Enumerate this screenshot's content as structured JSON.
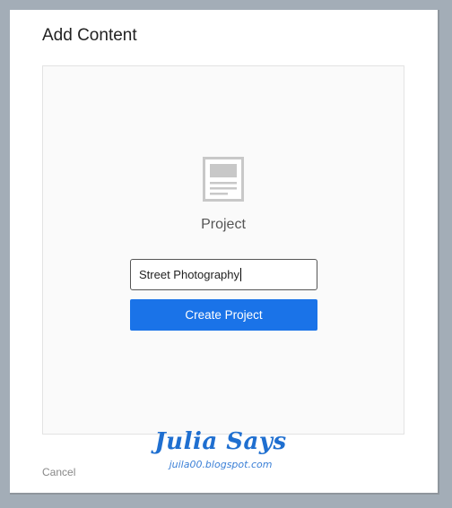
{
  "dialog": {
    "title": "Add Content",
    "cancel_label": "Cancel"
  },
  "panel": {
    "icon": "document-icon",
    "type_label": "Project",
    "name_input": {
      "value": "Street Photography"
    },
    "create_label": "Create Project"
  },
  "watermark": {
    "title": "Julia Says",
    "subtitle": "juila00.blogspot.com"
  },
  "colors": {
    "primary_button": "#1a73e8",
    "backdrop": "#a3adb7",
    "watermark": "#1f6fd0"
  }
}
